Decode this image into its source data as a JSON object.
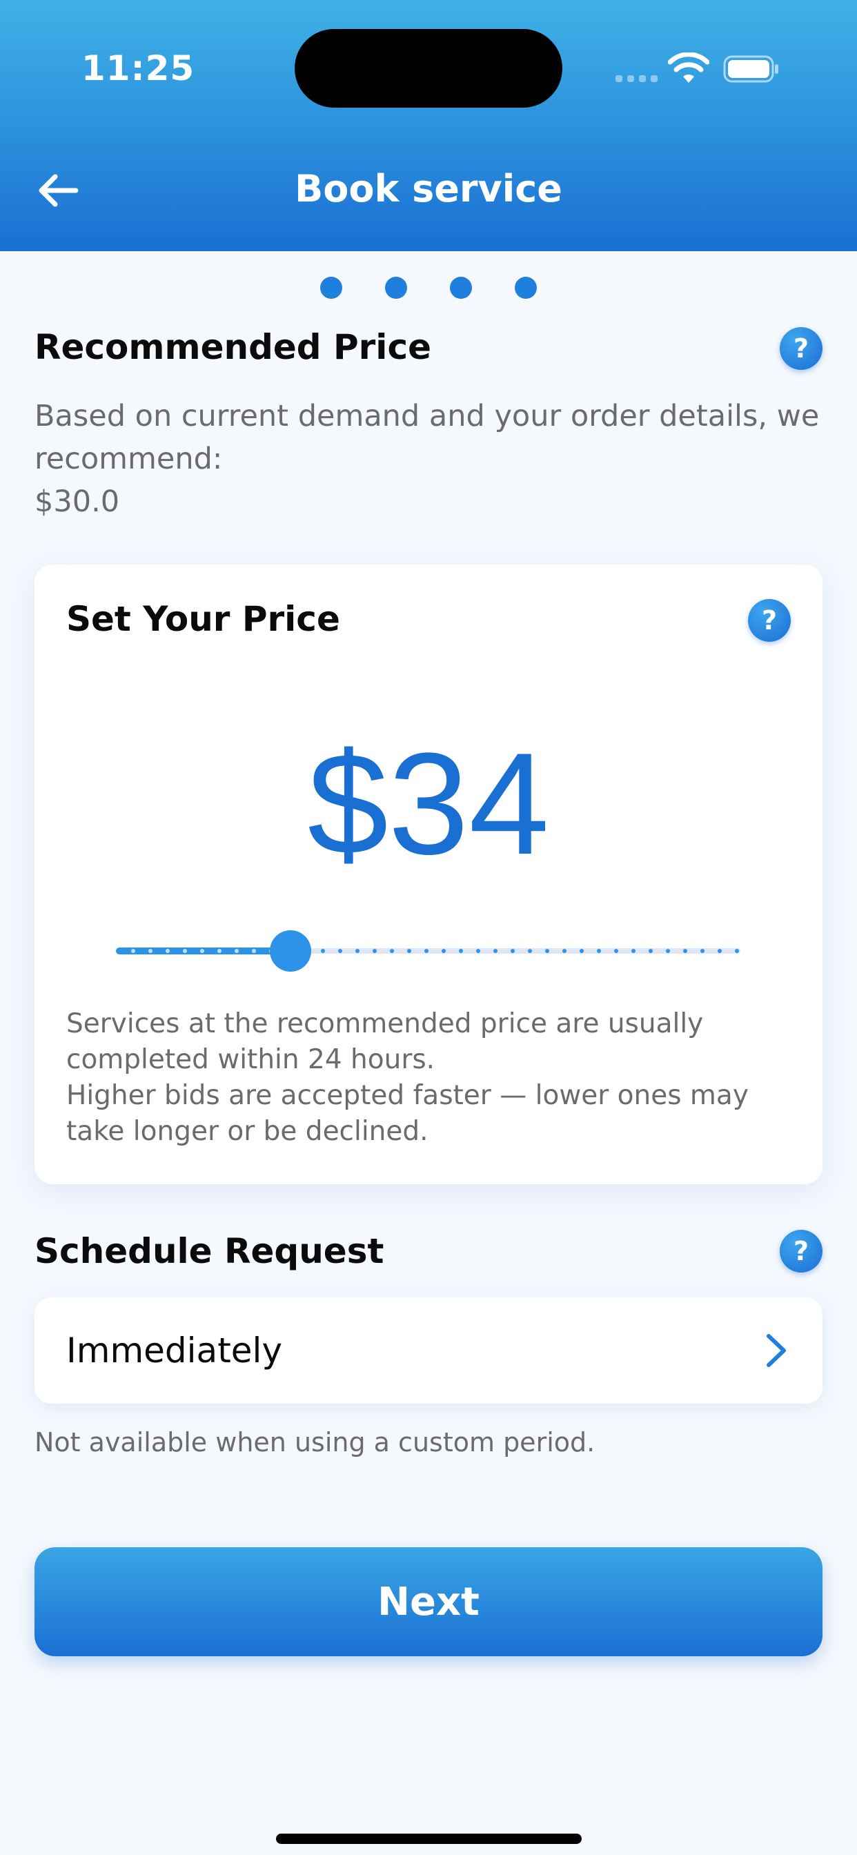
{
  "status_bar": {
    "time": "11:25"
  },
  "header": {
    "title": "Book service"
  },
  "steps": {
    "count": 4
  },
  "recommended": {
    "title": "Recommended Price",
    "description": "Based on current demand and your order details, we recommend:",
    "price": "$30.0",
    "help_label": "?"
  },
  "set_price": {
    "title": "Set Your Price",
    "help_label": "?",
    "value": "$34",
    "slider_fraction": 0.28,
    "note_line1": "Services at the recommended price are usually completed within 24 hours.",
    "note_line2": "Higher bids are accepted faster — lower ones may take longer or be declined."
  },
  "schedule": {
    "title": "Schedule Request",
    "help_label": "?",
    "value": "Immediately",
    "note": "Not available when using a custom period."
  },
  "next_button": {
    "label": "Next"
  },
  "colors": {
    "primary": "#1a6fd3",
    "accent": "#2d93e8",
    "header_top": "#3fb1e6",
    "background": "#f5f8fd"
  }
}
